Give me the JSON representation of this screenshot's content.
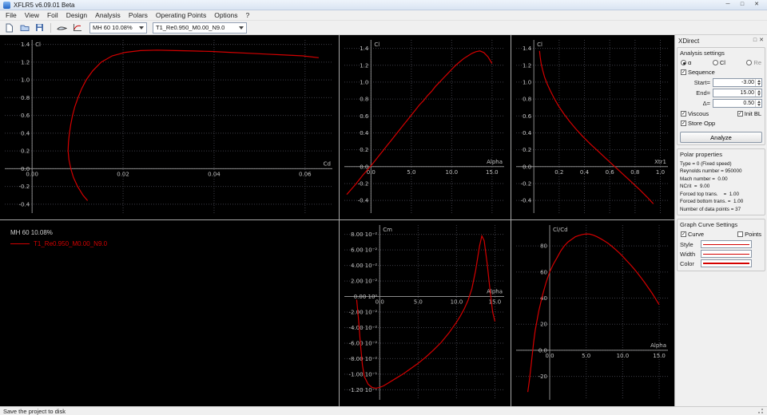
{
  "window": {
    "title": "XFLR5 v6.09.01 Beta"
  },
  "icons": {
    "minimize": "─",
    "maximize": "□",
    "close": "✕",
    "dock_float": "□",
    "dock_close": "✕",
    "check": "✓"
  },
  "menu": {
    "items": [
      "File",
      "View",
      "Foil",
      "Design",
      "Analysis",
      "Polars",
      "Operating Points",
      "Options",
      "?"
    ]
  },
  "toolbar": {
    "foil_selected": "MH 60 10.08%",
    "polar_selected": "T1_Re0.950_M0.00_N9.0"
  },
  "legend": {
    "foil_name": "MH 60 10.08%",
    "polar_name": "T1_Re0.950_M0.00_N9.0"
  },
  "statusbar": {
    "text": "Save the project to disk"
  },
  "dock": {
    "title": "XDirect",
    "analysis": {
      "title": "Analysis settings",
      "radio_alpha": "α",
      "radio_cl": "Cl",
      "radio_re": "Re",
      "sequence_label": "Sequence",
      "start_label": "Start=",
      "start_value": "-3.00",
      "end_label": "End=",
      "end_value": "15.00",
      "delta_label": "Δ=",
      "delta_value": "0.50",
      "viscous_label": "Viscous",
      "init_bl_label": "Init BL",
      "store_opp_label": "Store Opp",
      "analyze_label": "Analyze"
    },
    "polar_props": {
      "title": "Polar properties",
      "lines": [
        "Type = 0 (Fixed speed)",
        "Reynolds number = 950000",
        "Mach number =  0.00",
        "NCrit  =  9.00",
        "Forced top trans.    =  1.00",
        "Forced bottom trans. =  1.00",
        "Number of data points = 37"
      ]
    },
    "curve": {
      "title": "Graph Curve Settings",
      "curve_label": "Curve",
      "points_label": "Points",
      "style_label": "Style",
      "width_label": "Width",
      "color_label": "Color"
    }
  },
  "theme": {
    "plot_bg": "#000000",
    "grid": "#3d3d46",
    "axis": "#8a8a8a",
    "tick_text": "#c2c2c2",
    "curve": "#d40000"
  },
  "chart_data": [
    {
      "id": "cl_cd",
      "type": "line",
      "ylabel": "Cl",
      "xlabel": "Cd",
      "xlim": [
        -0.006,
        0.066
      ],
      "ylim": [
        -0.5,
        1.45
      ],
      "xticks": [
        {
          "v": 0,
          "l": "0.00"
        },
        {
          "v": 0.02,
          "l": "0.02"
        },
        {
          "v": 0.04,
          "l": "0.04"
        },
        {
          "v": 0.06,
          "l": "0.06"
        }
      ],
      "yticks": [
        {
          "v": -0.4,
          "l": "-0.4"
        },
        {
          "v": -0.2,
          "l": "-0.2"
        },
        {
          "v": 0,
          "l": "0.0"
        },
        {
          "v": 0.2,
          "l": "0.2"
        },
        {
          "v": 0.4,
          "l": "0.4"
        },
        {
          "v": 0.6,
          "l": "0.6"
        },
        {
          "v": 0.8,
          "l": "0.8"
        },
        {
          "v": 1.0,
          "l": "1.0"
        },
        {
          "v": 1.2,
          "l": "1.2"
        },
        {
          "v": 1.4,
          "l": "1.4"
        }
      ],
      "series": [
        {
          "name": "T1_Re0.950_M0.00_N9.0",
          "color": "#d40000",
          "x": [
            0.0122,
            0.0112,
            0.01,
            0.0091,
            0.0085,
            0.0081,
            0.0079,
            0.008,
            0.0082,
            0.0085,
            0.0089,
            0.0094,
            0.0101,
            0.0109,
            0.0119,
            0.0133,
            0.0152,
            0.0176,
            0.0205,
            0.0238,
            0.0275,
            0.0315,
            0.0355,
            0.0395,
            0.0435,
            0.0475,
            0.0515,
            0.0555,
            0.0595,
            0.063
          ],
          "y": [
            -0.36,
            -0.3,
            -0.2,
            -0.1,
            0,
            0.1,
            0.2,
            0.3,
            0.4,
            0.5,
            0.6,
            0.7,
            0.8,
            0.9,
            1.0,
            1.1,
            1.2,
            1.27,
            1.31,
            1.33,
            1.335,
            1.33,
            1.325,
            1.32,
            1.31,
            1.3,
            1.29,
            1.28,
            1.27,
            1.25
          ]
        }
      ]
    },
    {
      "id": "cl_alpha",
      "type": "line",
      "ylabel": "Cl",
      "xlabel": "Alpha",
      "xlim": [
        -3.3,
        16.5
      ],
      "ylim": [
        -0.55,
        1.5
      ],
      "xticks": [
        {
          "v": 0,
          "l": "0.0"
        },
        {
          "v": 5,
          "l": "5.0"
        },
        {
          "v": 10,
          "l": "10.0"
        },
        {
          "v": 15,
          "l": "15.0"
        }
      ],
      "yticks": [
        {
          "v": -0.4,
          "l": "-0.4"
        },
        {
          "v": -0.2,
          "l": "-0.2"
        },
        {
          "v": 0,
          "l": "0.0"
        },
        {
          "v": 0.2,
          "l": "0.2"
        },
        {
          "v": 0.4,
          "l": "0.4"
        },
        {
          "v": 0.6,
          "l": "0.6"
        },
        {
          "v": 0.8,
          "l": "0.8"
        },
        {
          "v": 1.0,
          "l": "1.0"
        },
        {
          "v": 1.2,
          "l": "1.2"
        },
        {
          "v": 1.4,
          "l": "1.4"
        }
      ],
      "series": [
        {
          "name": "T1_Re0.950_M0.00_N9.0",
          "color": "#d40000",
          "x": [
            -3,
            -2.5,
            -2,
            -1.5,
            -1,
            -0.5,
            0,
            0.5,
            1,
            1.5,
            2,
            2.5,
            3,
            3.5,
            4,
            4.5,
            5,
            5.5,
            6,
            6.5,
            7,
            7.5,
            8,
            8.5,
            9,
            9.5,
            10,
            10.5,
            11,
            11.5,
            12,
            12.5,
            13,
            13.5,
            14,
            14.5,
            15
          ],
          "y": [
            -0.33,
            -0.275,
            -0.22,
            -0.16,
            -0.1,
            -0.045,
            0.01,
            0.07,
            0.13,
            0.19,
            0.25,
            0.31,
            0.37,
            0.43,
            0.49,
            0.55,
            0.61,
            0.67,
            0.73,
            0.78,
            0.84,
            0.89,
            0.95,
            1.0,
            1.05,
            1.1,
            1.15,
            1.2,
            1.24,
            1.28,
            1.31,
            1.34,
            1.36,
            1.37,
            1.35,
            1.3,
            1.22
          ]
        }
      ]
    },
    {
      "id": "cl_xtr",
      "type": "line",
      "ylabel": "Cl",
      "xlabel": "Xtr1",
      "xlim": [
        -0.14,
        1.06
      ],
      "ylim": [
        -0.55,
        1.5
      ],
      "xticks": [
        {
          "v": 0.2,
          "l": "0.2"
        },
        {
          "v": 0.4,
          "l": "0.4"
        },
        {
          "v": 0.6,
          "l": "0.6"
        },
        {
          "v": 0.8,
          "l": "0.8"
        },
        {
          "v": 1.0,
          "l": "1.0"
        }
      ],
      "yticks": [
        {
          "v": -0.4,
          "l": "-0.4"
        },
        {
          "v": -0.2,
          "l": "-0.2"
        },
        {
          "v": 0,
          "l": "0.0"
        },
        {
          "v": 0.2,
          "l": "0.2"
        },
        {
          "v": 0.4,
          "l": "0.4"
        },
        {
          "v": 0.6,
          "l": "0.6"
        },
        {
          "v": 0.8,
          "l": "0.8"
        },
        {
          "v": 1.0,
          "l": "1.0"
        },
        {
          "v": 1.2,
          "l": "1.2"
        },
        {
          "v": 1.4,
          "l": "1.4"
        }
      ],
      "series": [
        {
          "name": "T1_Re0.950_M0.00_N9.0",
          "color": "#d40000",
          "x": [
            0.045,
            0.05,
            0.058,
            0.07,
            0.085,
            0.105,
            0.13,
            0.16,
            0.195,
            0.235,
            0.28,
            0.33,
            0.385,
            0.445,
            0.51,
            0.575,
            0.64,
            0.705,
            0.77,
            0.835,
            0.895,
            0.945
          ],
          "y": [
            1.37,
            1.3,
            1.22,
            1.14,
            1.06,
            0.98,
            0.9,
            0.81,
            0.72,
            0.63,
            0.54,
            0.45,
            0.36,
            0.27,
            0.18,
            0.09,
            0.0,
            -0.09,
            -0.18,
            -0.27,
            -0.36,
            -0.44
          ]
        }
      ]
    },
    {
      "id": "cm_alpha",
      "type": "line",
      "ylabel": "Cm",
      "xlabel": "Alpha",
      "xlim": [
        -4.6,
        16.2
      ],
      "ylim": [
        -0.133,
        0.092
      ],
      "xticks": [
        {
          "v": 0,
          "l": "0.0"
        },
        {
          "v": 5,
          "l": "5.0"
        },
        {
          "v": 10,
          "l": "10.0"
        },
        {
          "v": 15,
          "l": "15.0"
        }
      ],
      "yticks": [
        {
          "v": 0.08,
          "l": "8.00 10⁻²"
        },
        {
          "v": 0.06,
          "l": "6.00 10⁻²"
        },
        {
          "v": 0.04,
          "l": "4.00 10⁻²"
        },
        {
          "v": 0.02,
          "l": "2.00 10⁻²"
        },
        {
          "v": 0,
          "l": "0.00 10⁰"
        },
        {
          "v": -0.02,
          "l": "-2.00 10⁻²"
        },
        {
          "v": -0.04,
          "l": "-4.00 10⁻²"
        },
        {
          "v": -0.06,
          "l": "-6.00 10⁻²"
        },
        {
          "v": -0.08,
          "l": "-8.00 10⁻²"
        },
        {
          "v": -0.1,
          "l": "-1.00 10⁻¹"
        },
        {
          "v": -0.12,
          "l": "-1.20 10⁻¹"
        }
      ],
      "series": [
        {
          "name": "T1_Re0.950_M0.00_N9.0",
          "color": "#d40000",
          "x": [
            -3,
            -2.75,
            -2.5,
            -2.25,
            -2,
            -1.5,
            -1,
            -0.5,
            0,
            0.5,
            1,
            2,
            3,
            4,
            5,
            6,
            7,
            8,
            9,
            10,
            10.5,
            11,
            11.5,
            12,
            12.5,
            13,
            13.3,
            13.6,
            14,
            14.4,
            14.7,
            15
          ],
          "y": [
            -0.004,
            -0.03,
            -0.062,
            -0.088,
            -0.103,
            -0.113,
            -0.117,
            -0.118,
            -0.117,
            -0.115,
            -0.112,
            -0.106,
            -0.1,
            -0.093,
            -0.086,
            -0.078,
            -0.069,
            -0.059,
            -0.047,
            -0.033,
            -0.025,
            -0.016,
            -0.005,
            0.01,
            0.034,
            0.065,
            0.078,
            0.072,
            0.042,
            0.005,
            -0.02,
            -0.032
          ]
        }
      ]
    },
    {
      "id": "clcd_alpha",
      "type": "line",
      "ylabel": "Cl/Cd",
      "xlabel": "Alpha",
      "xlim": [
        -4.6,
        16.2
      ],
      "ylim": [
        -38,
        96
      ],
      "xticks": [
        {
          "v": 0,
          "l": "0.0"
        },
        {
          "v": 5,
          "l": "5.0"
        },
        {
          "v": 10,
          "l": "10.0"
        },
        {
          "v": 15,
          "l": "15.0"
        }
      ],
      "yticks": [
        {
          "v": -20,
          "l": "-20"
        },
        {
          "v": 0,
          "l": "0.0"
        },
        {
          "v": 20,
          "l": "20"
        },
        {
          "v": 40,
          "l": "40"
        },
        {
          "v": 60,
          "l": "60"
        },
        {
          "v": 80,
          "l": "80"
        }
      ],
      "series": [
        {
          "name": "T1_Re0.950_M0.00_N9.0",
          "color": "#d40000",
          "x": [
            -3,
            -2.8,
            -2.6,
            -2.4,
            -2.2,
            -2,
            -1.5,
            -1,
            -0.5,
            0,
            0.5,
            1,
            1.5,
            2,
            2.5,
            3,
            3.5,
            4,
            4.5,
            5,
            5.5,
            6,
            6.5,
            7,
            7.5,
            8,
            8.5,
            9,
            9.5,
            10,
            10.5,
            11,
            11.5,
            12,
            12.5,
            13,
            13.5,
            14,
            14.5,
            15
          ],
          "y": [
            -32,
            -24,
            -14,
            -4,
            6,
            15,
            30,
            42,
            52,
            60,
            66,
            71,
            76,
            80,
            83,
            85,
            87,
            88,
            88.8,
            89.2,
            89,
            88.2,
            87,
            85.5,
            83.8,
            82,
            79.8,
            77.4,
            74.8,
            72,
            69,
            66,
            62.8,
            59.4,
            55.8,
            52,
            48,
            44,
            39.5,
            35
          ]
        }
      ]
    }
  ]
}
